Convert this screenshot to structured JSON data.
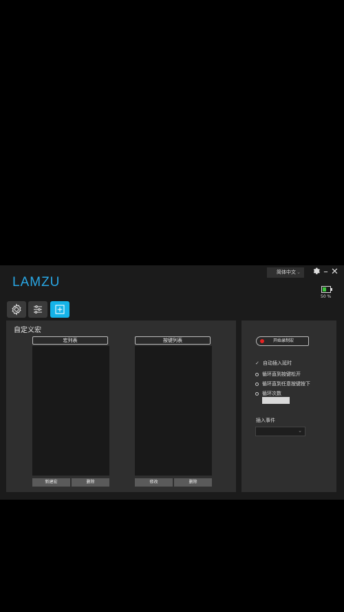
{
  "app": {
    "logo": "LAMZU",
    "language": "简体中文",
    "battery": {
      "percent_label": "50 %",
      "level": 0.5,
      "color": "#3ec73e"
    },
    "accent": "#15b3e8"
  },
  "tabs": [
    {
      "name": "settings",
      "icon": "gear-icon",
      "active": false
    },
    {
      "name": "adjust",
      "icon": "sliders-icon",
      "active": false
    },
    {
      "name": "macro",
      "icon": "macro-plus-icon",
      "active": true
    }
  ],
  "macro": {
    "title": "自定义宏",
    "macro_list_header": "宏列表",
    "key_list_header": "按键列表",
    "new_macro": "新建宏",
    "delete_macro": "删除",
    "modify_key": "修改",
    "delete_key": "删除"
  },
  "recording": {
    "start_button": "开始录制宏",
    "options": [
      {
        "label": "自动插入延时",
        "type": "checkbox",
        "checked": true
      },
      {
        "label": "循环直到按键松开",
        "type": "radio"
      },
      {
        "label": "循环直到任意按键按下",
        "type": "radio"
      },
      {
        "label": "循环次数",
        "type": "radio"
      }
    ],
    "insert_event_label": "插入事件",
    "insert_event_value": ""
  }
}
